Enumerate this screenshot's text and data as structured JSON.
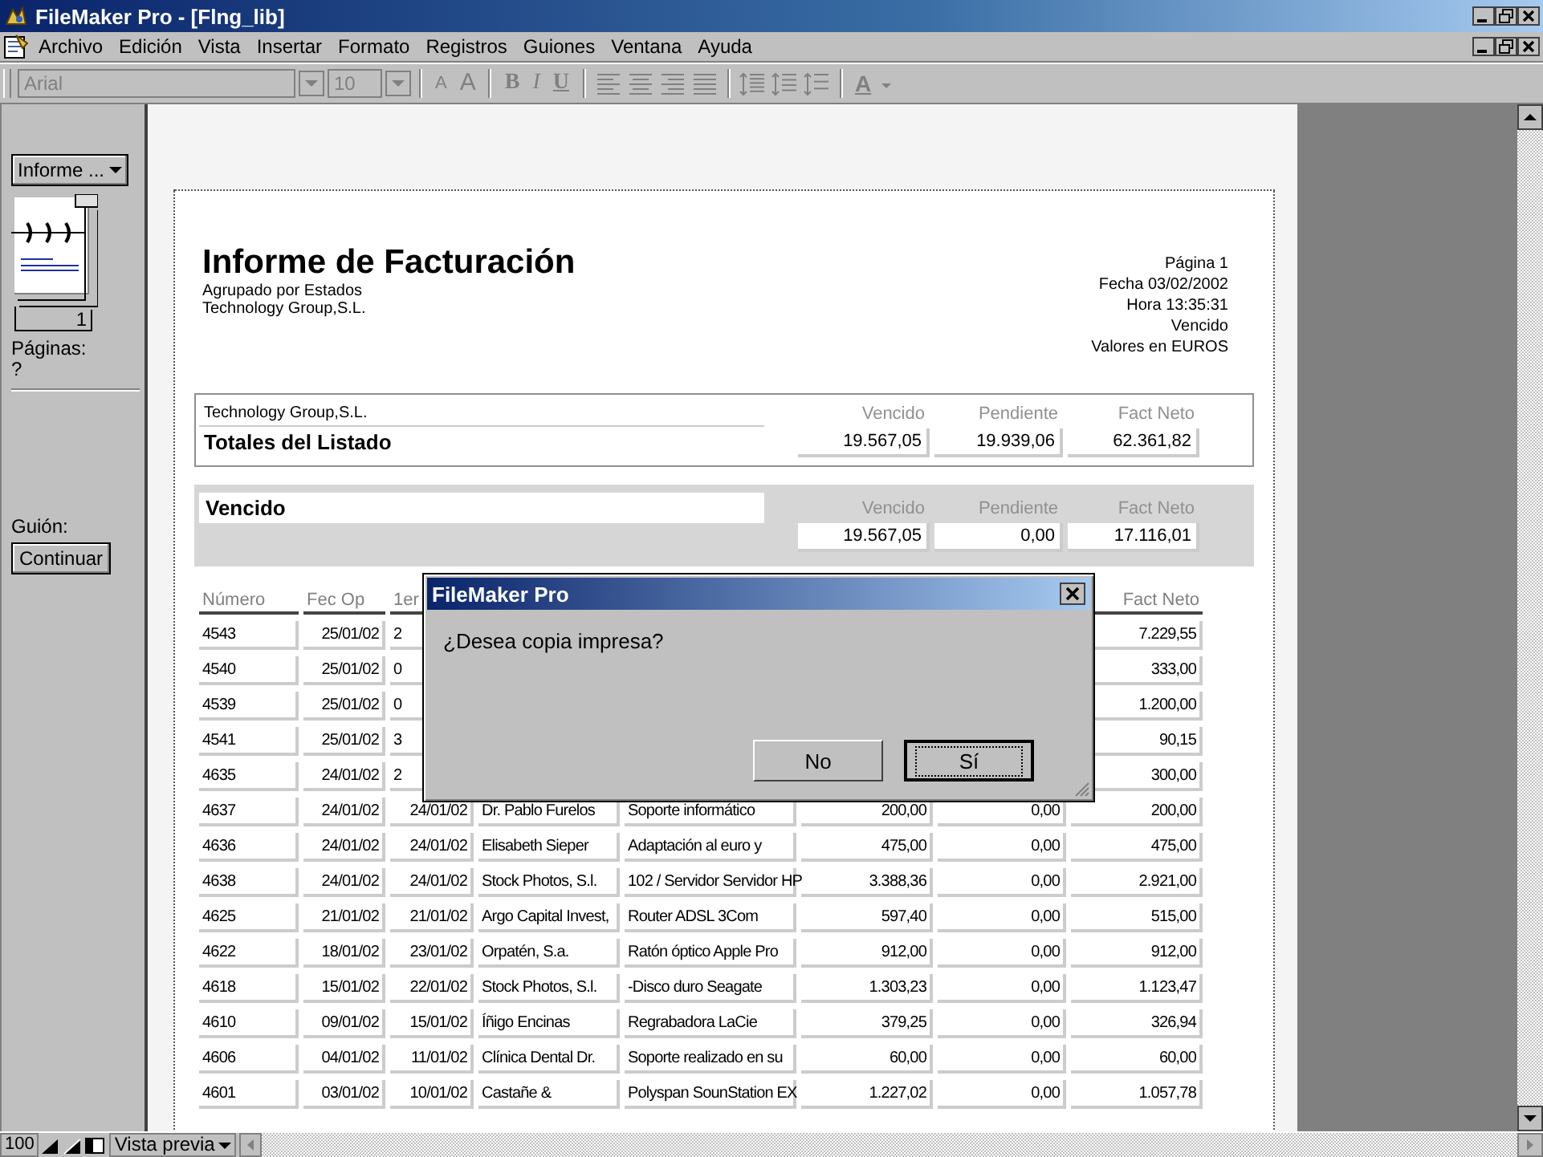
{
  "window": {
    "title": "FileMaker Pro - [Flng_lib]"
  },
  "menu": [
    {
      "label": "Archivo"
    },
    {
      "label": "Edición"
    },
    {
      "label": "Vista"
    },
    {
      "label": "Insertar"
    },
    {
      "label": "Formato"
    },
    {
      "label": "Registros"
    },
    {
      "label": "Guiones"
    },
    {
      "label": "Ventana"
    },
    {
      "label": "Ayuda"
    }
  ],
  "toolbar": {
    "font_field": {
      "value": "Arial",
      "disabled": true
    },
    "size_field": {
      "value": "10",
      "disabled": true
    },
    "size_buttons": [
      {
        "label": "A",
        "kind": "smaller"
      },
      {
        "label": "A",
        "kind": "larger"
      }
    ],
    "style_buttons": [
      {
        "label": "B",
        "kind": "bold"
      },
      {
        "label": "I",
        "kind": "italic"
      },
      {
        "label": "U",
        "kind": "underline"
      }
    ],
    "color_button": {
      "label": "A"
    }
  },
  "sidebar": {
    "mode_menu": "Informe ...",
    "page_number": "1",
    "pages_label": "Páginas:",
    "pages_value": "?",
    "script_label": "Guión:",
    "continue_button": "Continuar"
  },
  "report": {
    "title": "Informe de Facturación",
    "subtitle": "Agrupado por Estados",
    "company": "Technology Group,S.L.",
    "info": [
      "Página 1",
      "Fecha 03/02/2002",
      "Hora 13:35:31",
      "Vencido",
      "Valores en EUROS"
    ],
    "totals": {
      "company": "Technology Group,S.L.",
      "label": "Totales del Listado",
      "columns": [
        "Vencido",
        "Pendiente",
        "Fact Neto"
      ],
      "values": [
        "19.567,05",
        "19.939,06",
        "62.361,82"
      ]
    },
    "group": {
      "label": "Vencido",
      "columns": [
        "Vencido",
        "Pendiente",
        "Fact Neto"
      ],
      "values": [
        "19.567,05",
        "0,00",
        "17.116,01"
      ]
    },
    "table": {
      "columns": [
        "Número",
        "Fec Op",
        "1er",
        null,
        null,
        null,
        null,
        "Fact Neto"
      ],
      "rows": [
        [
          "4543",
          "25/01/02",
          "2",
          null,
          null,
          null,
          null,
          "7.229,55"
        ],
        [
          "4540",
          "25/01/02",
          "0",
          null,
          null,
          null,
          null,
          "333,00"
        ],
        [
          "4539",
          "25/01/02",
          "0",
          null,
          null,
          null,
          null,
          "1.200,00"
        ],
        [
          "4541",
          "25/01/02",
          "3",
          null,
          null,
          null,
          null,
          "90,15"
        ],
        [
          "4635",
          "24/01/02",
          "2",
          null,
          null,
          null,
          null,
          "300,00"
        ],
        [
          "4637",
          "24/01/02",
          "24/01/02",
          "Dr. Pablo Furelos",
          "Soporte informático",
          "200,00",
          "0,00",
          "200,00"
        ],
        [
          "4636",
          "24/01/02",
          "24/01/02",
          "Elisabeth Sieper",
          "Adaptación al euro y",
          "475,00",
          "0,00",
          "475,00"
        ],
        [
          "4638",
          "24/01/02",
          "24/01/02",
          "Stock Photos, S.l.",
          "102 / Servidor Servidor HP",
          "3.388,36",
          "0,00",
          "2.921,00"
        ],
        [
          "4625",
          "21/01/02",
          "21/01/02",
          "Argo Capital Invest,",
          "Router ADSL 3Com",
          "597,40",
          "0,00",
          "515,00"
        ],
        [
          "4622",
          "18/01/02",
          "23/01/02",
          "Orpatén, S.a.",
          "Ratón óptico Apple Pro",
          "912,00",
          "0,00",
          "912,00"
        ],
        [
          "4618",
          "15/01/02",
          "22/01/02",
          "Stock Photos, S.l.",
          "-Disco duro Seagate",
          "1.303,23",
          "0,00",
          "1.123,47"
        ],
        [
          "4610",
          "09/01/02",
          "15/01/02",
          "Íñigo Encinas",
          "Regrabadora LaCie",
          "379,25",
          "0,00",
          "326,94"
        ],
        [
          "4606",
          "04/01/02",
          "11/01/02",
          "Clínica Dental Dr.",
          "Soporte realizado en su",
          "60,00",
          "0,00",
          "60,00"
        ],
        [
          "4601",
          "03/01/02",
          "10/01/02",
          "Castañe &",
          "Polyspan SounStation EX",
          "1.227,02",
          "0,00",
          "1.057,78"
        ]
      ]
    }
  },
  "dialog": {
    "title": "FileMaker Pro",
    "message": "¿Desea copia impresa?",
    "buttons": [
      {
        "label": "No",
        "default": false
      },
      {
        "label": "Sí",
        "default": true
      }
    ]
  },
  "status_bar": {
    "zoom": "100",
    "mode": "Vista previa"
  }
}
